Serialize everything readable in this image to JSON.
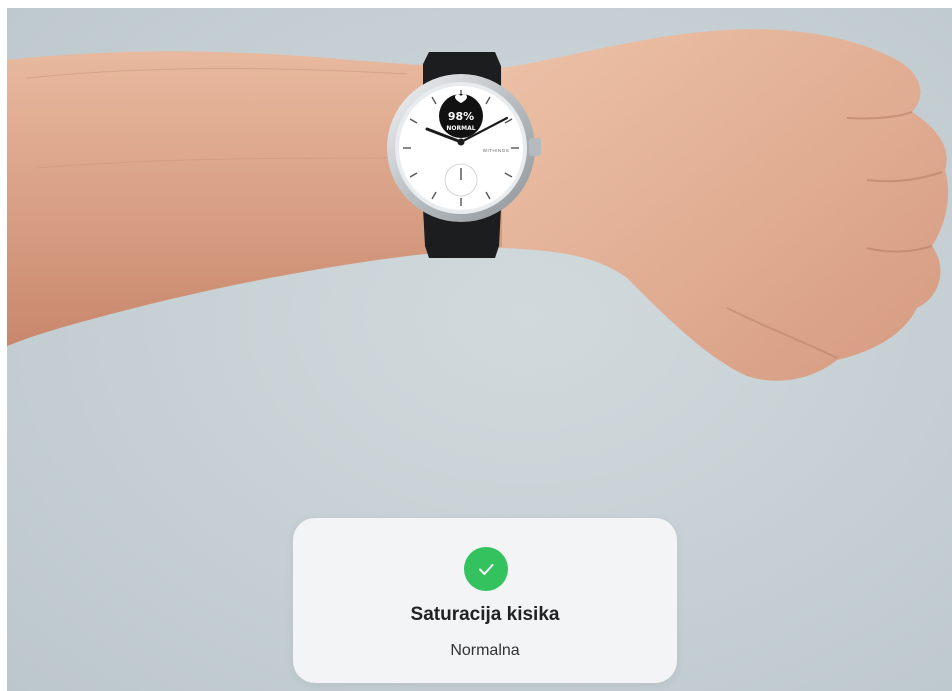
{
  "watch": {
    "spo2_value": "98%",
    "spo2_status": "NORMAL",
    "brand": "WITHINGS"
  },
  "result_card": {
    "icon": "check-circle-icon",
    "title": "Saturacija kisika",
    "value": "Normalna",
    "accent_color": "#34c25e"
  }
}
